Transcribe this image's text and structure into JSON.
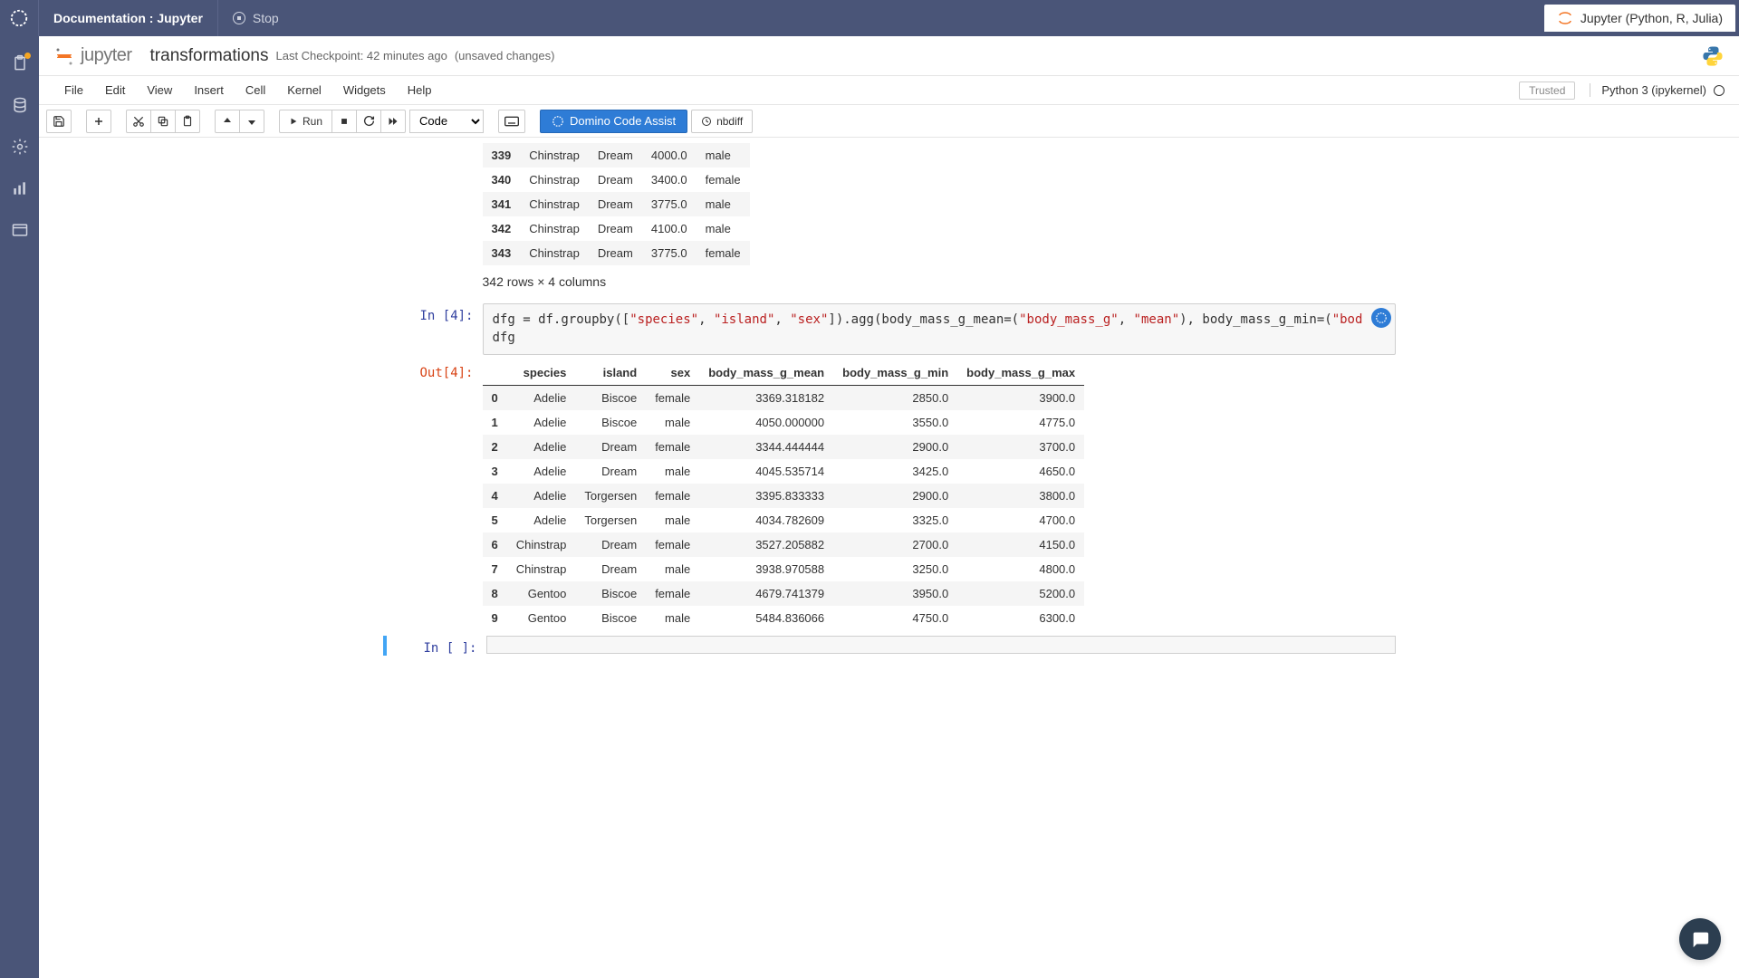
{
  "topbar": {
    "doc_title": "Documentation : Jupyter",
    "stop": "Stop",
    "env_tab": "Jupyter (Python, R, Julia)"
  },
  "header": {
    "logo_word": "jupyter",
    "title": "transformations",
    "checkpoint": "Last Checkpoint: 42 minutes ago",
    "unsaved": "(unsaved changes)"
  },
  "menu": {
    "file": "File",
    "edit": "Edit",
    "view": "View",
    "insert": "Insert",
    "cell": "Cell",
    "kernel": "Kernel",
    "widgets": "Widgets",
    "help": "Help",
    "trusted": "Trusted",
    "kernel_name": "Python 3 (ipykernel)"
  },
  "toolbar": {
    "run": "Run",
    "cell_type": "Code",
    "domino": "Domino Code Assist",
    "nbdiff": "nbdiff"
  },
  "cells": {
    "out3_fragment": {
      "rows": [
        [
          "339",
          "Chinstrap",
          "Dream",
          "4000.0",
          "male"
        ],
        [
          "340",
          "Chinstrap",
          "Dream",
          "3400.0",
          "female"
        ],
        [
          "341",
          "Chinstrap",
          "Dream",
          "3775.0",
          "male"
        ],
        [
          "342",
          "Chinstrap",
          "Dream",
          "4100.0",
          "male"
        ],
        [
          "343",
          "Chinstrap",
          "Dream",
          "3775.0",
          "female"
        ]
      ],
      "summary": "342 rows × 4 columns"
    },
    "cell4": {
      "in_prompt": "In [4]:",
      "out_prompt": "Out[4]:",
      "code_prefix": "dfg = df.groupby([",
      "code_s1": "\"species\"",
      "code_s2": "\"island\"",
      "code_s3": "\"sex\"",
      "code_mid": "]).agg(body_mass_g_mean=(",
      "code_s4": "\"body_mass_g\"",
      "code_s5": "\"mean\"",
      "code_mid2": "), body_mass_g_min=(",
      "code_s6": "\"bod",
      "code_line2": "dfg",
      "headers": [
        "",
        "species",
        "island",
        "sex",
        "body_mass_g_mean",
        "body_mass_g_min",
        "body_mass_g_max"
      ],
      "rows": [
        [
          "0",
          "Adelie",
          "Biscoe",
          "female",
          "3369.318182",
          "2850.0",
          "3900.0"
        ],
        [
          "1",
          "Adelie",
          "Biscoe",
          "male",
          "4050.000000",
          "3550.0",
          "4775.0"
        ],
        [
          "2",
          "Adelie",
          "Dream",
          "female",
          "3344.444444",
          "2900.0",
          "3700.0"
        ],
        [
          "3",
          "Adelie",
          "Dream",
          "male",
          "4045.535714",
          "3425.0",
          "4650.0"
        ],
        [
          "4",
          "Adelie",
          "Torgersen",
          "female",
          "3395.833333",
          "2900.0",
          "3800.0"
        ],
        [
          "5",
          "Adelie",
          "Torgersen",
          "male",
          "4034.782609",
          "3325.0",
          "4700.0"
        ],
        [
          "6",
          "Chinstrap",
          "Dream",
          "female",
          "3527.205882",
          "2700.0",
          "4150.0"
        ],
        [
          "7",
          "Chinstrap",
          "Dream",
          "male",
          "3938.970588",
          "3250.0",
          "4800.0"
        ],
        [
          "8",
          "Gentoo",
          "Biscoe",
          "female",
          "4679.741379",
          "3950.0",
          "5200.0"
        ],
        [
          "9",
          "Gentoo",
          "Biscoe",
          "male",
          "5484.836066",
          "4750.0",
          "6300.0"
        ]
      ]
    },
    "empty": {
      "prompt": "In [ ]:"
    }
  }
}
